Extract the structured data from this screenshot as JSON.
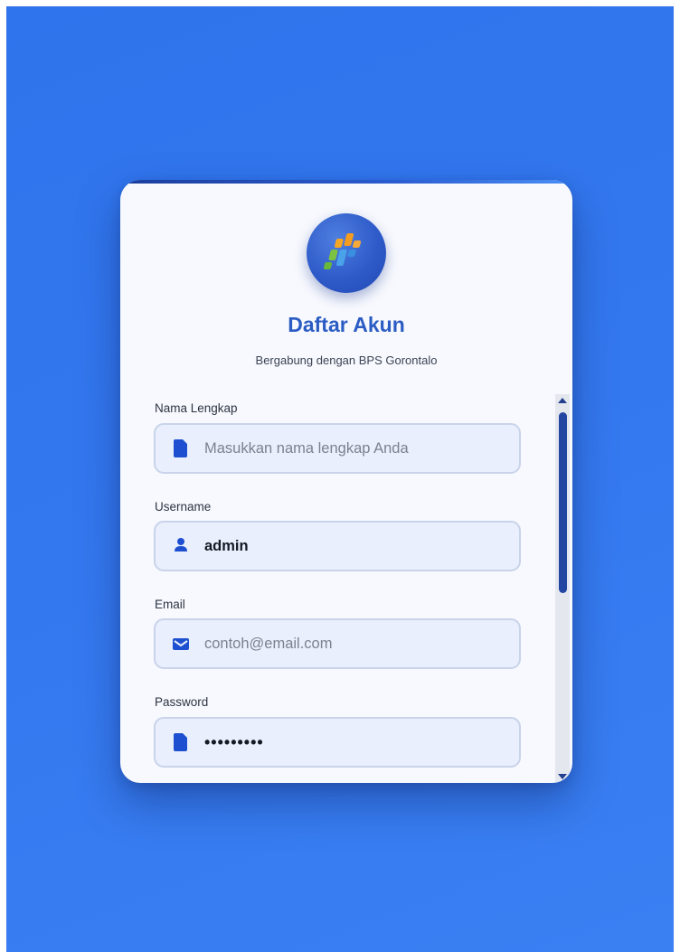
{
  "page": {
    "title": "Daftar Akun",
    "subtitle": "Bergabung dengan BPS Gorontalo"
  },
  "form": {
    "full_name": {
      "label": "Nama Lengkap",
      "placeholder": "Masukkan nama lengkap Anda",
      "value": "",
      "icon": "file-icon"
    },
    "username": {
      "label": "Username",
      "placeholder": "",
      "value": "admin",
      "icon": "user-icon"
    },
    "email": {
      "label": "Email",
      "placeholder": "contoh@email.com",
      "value": "",
      "icon": "envelope-icon"
    },
    "password": {
      "label": "Password",
      "placeholder": "",
      "value": "•••••••••",
      "icon": "file-icon"
    }
  },
  "colors": {
    "background": "#3178ee",
    "card": "#f7f9fe",
    "accent": "#2b5cc4",
    "icon": "#1d4fd0",
    "field_bg": "#e9effc",
    "field_border": "#c9d3ea",
    "scroll_thumb": "#2446a3"
  },
  "logo": {
    "icon": "bps-logo-icon"
  }
}
